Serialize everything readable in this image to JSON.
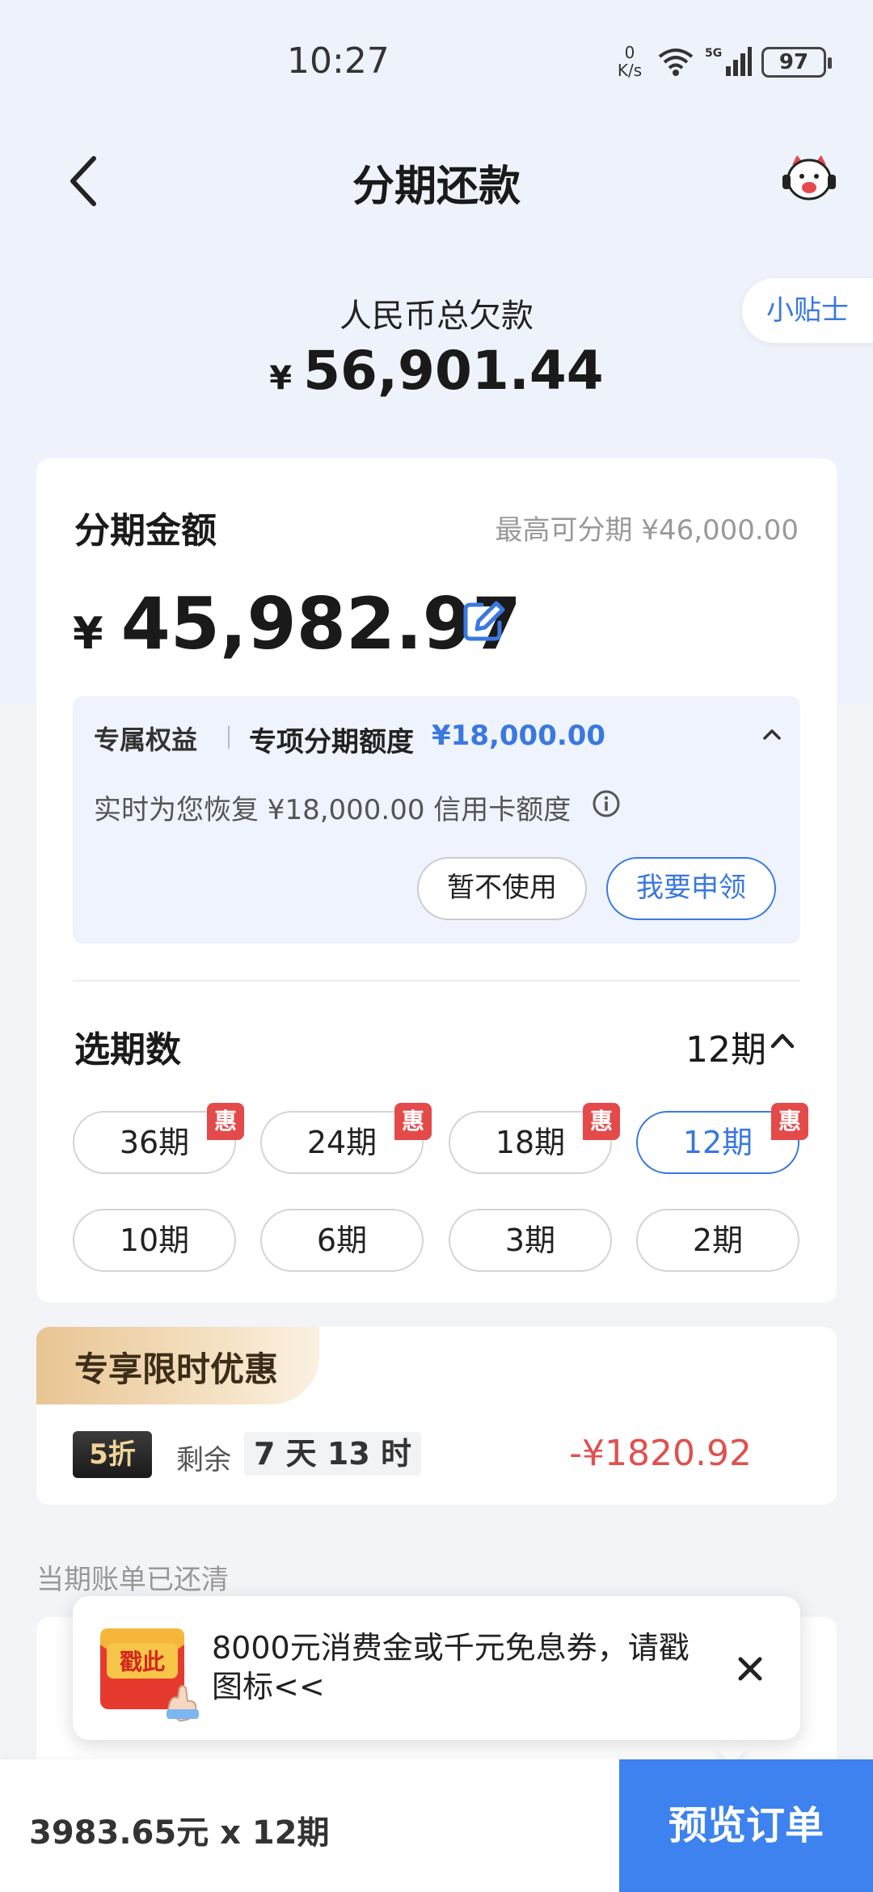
{
  "status_bar": {
    "time": "10:27",
    "net_speed_value": "0",
    "net_speed_unit": "K/s",
    "network": "5G",
    "battery": "97"
  },
  "nav": {
    "title": "分期还款",
    "back_icon": "chevron-left-icon",
    "assistant_icon": "mascot-icon"
  },
  "total": {
    "label": "人民币总欠款",
    "currency": "¥",
    "amount": "56,901.44",
    "tips_label": "小贴士"
  },
  "installment": {
    "title": "分期金额",
    "max_label": "最高可分期 ¥46,000.00",
    "currency": "¥",
    "amount": "45,982.97",
    "benefit": {
      "tag": "专属权益",
      "name": "专项分期额度",
      "amount": "¥18,000.00",
      "description": "实时为您恢复 ¥18,000.00 信用卡额度",
      "decline_label": "暂不使用",
      "apply_label": "我要申领"
    }
  },
  "periods": {
    "title": "选期数",
    "selected": "12期",
    "badge_label": "惠",
    "options": [
      {
        "label": "36期",
        "badge": true,
        "selected": false
      },
      {
        "label": "24期",
        "badge": true,
        "selected": false
      },
      {
        "label": "18期",
        "badge": true,
        "selected": false
      },
      {
        "label": "12期",
        "badge": true,
        "selected": true
      },
      {
        "label": "10期",
        "badge": false,
        "selected": false
      },
      {
        "label": "6期",
        "badge": false,
        "selected": false
      },
      {
        "label": "3期",
        "badge": false,
        "selected": false
      },
      {
        "label": "2期",
        "badge": false,
        "selected": false
      }
    ]
  },
  "promo": {
    "title": "专享限时优惠",
    "discount": "5折",
    "remain_label": "剩余",
    "remain_time": "7 天 13 时",
    "saving": "-¥1820.92"
  },
  "bill_status": "当期账单已还清",
  "popup": {
    "icon_text": "戳此",
    "text": "8000元消费金或千元免息券，请戳图标<<",
    "close_icon": "close-icon"
  },
  "bottom": {
    "summary": "3983.65元 x 12期",
    "preview_label": "预览订单"
  },
  "colors": {
    "accent": "#3a78e0",
    "button": "#3d82ee",
    "badge": "#e44a4a",
    "saving": "#e05050"
  }
}
